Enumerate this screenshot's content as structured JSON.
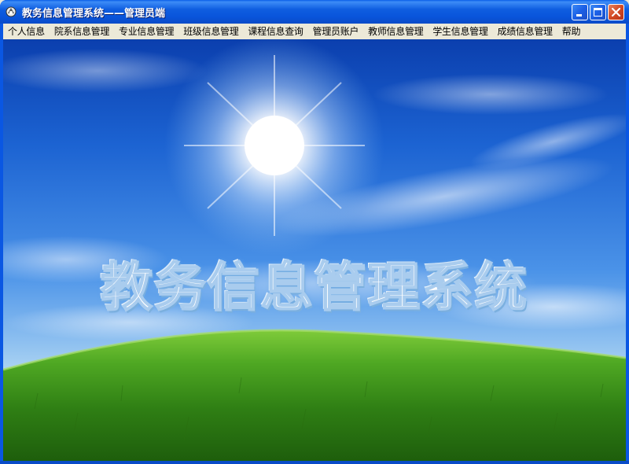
{
  "window": {
    "title": "教务信息管理系统——管理员端",
    "icon": "app-icon",
    "buttons": [
      "minimize-icon",
      "maximize-icon",
      "close-icon"
    ]
  },
  "menu": {
    "items": [
      {
        "label": "个人信息"
      },
      {
        "label": "院系信息管理"
      },
      {
        "label": "专业信息管理"
      },
      {
        "label": "班级信息管理"
      },
      {
        "label": "课程信息查询"
      },
      {
        "label": "管理员账户"
      },
      {
        "label": "教师信息管理"
      },
      {
        "label": "学生信息管理"
      },
      {
        "label": "成绩信息管理"
      },
      {
        "label": "帮助"
      }
    ]
  },
  "main": {
    "banner_text": "教务信息管理系统",
    "background": "sky-and-grass-image"
  },
  "colors": {
    "titlebar": "#0A5FE8",
    "menubar": "#ECE9D8",
    "close_button": "#D44A23",
    "sky": "#1C63D2",
    "grass": "#3E9A1A"
  }
}
